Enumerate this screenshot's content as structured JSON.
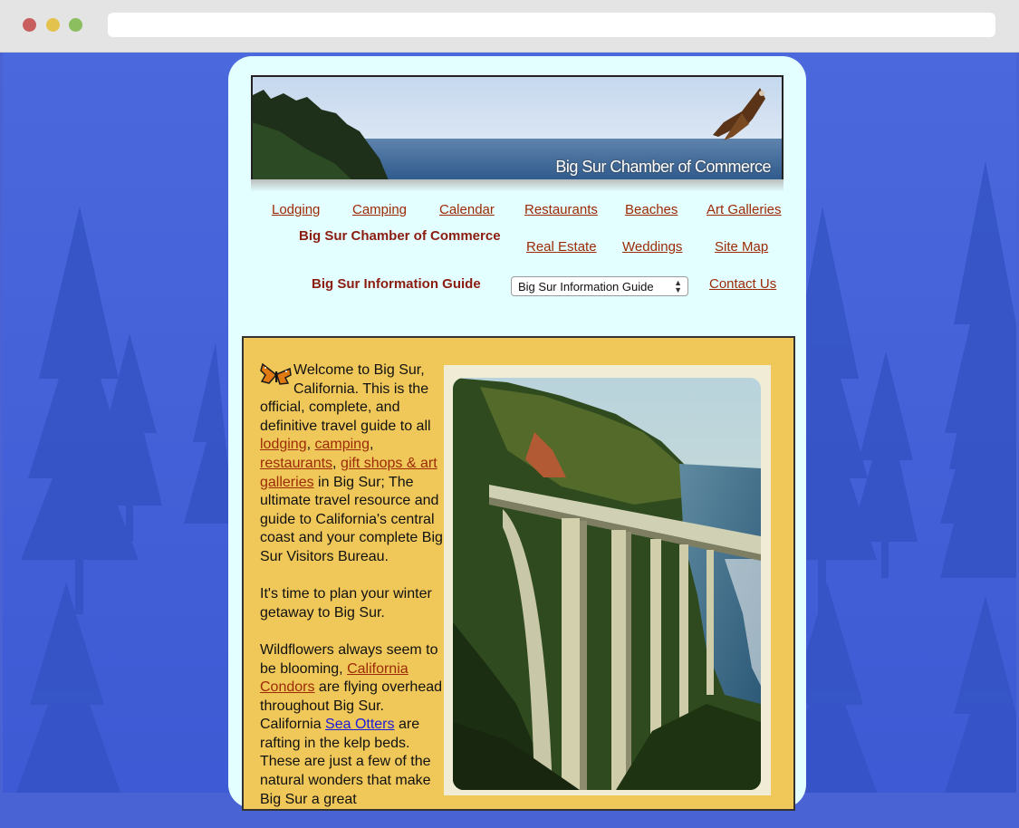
{
  "browser": {
    "url": ""
  },
  "banner": {
    "title": "Big Sur Chamber of Commerce"
  },
  "nav": {
    "lodging": "Lodging",
    "camping": "Camping",
    "calendar": "Calendar",
    "restaurants": "Restaurants",
    "beaches": "Beaches",
    "art_galleries": "Art Galleries",
    "real_estate": "Real Estate",
    "weddings": "Weddings",
    "site_map": "Site Map",
    "contact_us": "Contact Us",
    "chamber_label": "Big Sur Chamber of Commerce",
    "guide_label": "Big Sur Information Guide"
  },
  "guide_select": {
    "selected": "Big Sur Information Guide"
  },
  "content": {
    "p1_text_a": "Welcome to Big Sur, California. This is the official, complete, and definitive travel guide to all ",
    "link_lodging": "lodging",
    "sep1": ", ",
    "link_camping": "camping",
    "sep2": ", ",
    "link_restaurants": "restaurants",
    "sep3": ", ",
    "link_gifts": "gift shops & art galleries",
    "p1_text_b": " in Big Sur; The ultimate travel resource and guide to California's central coast and your complete Big Sur Visitors Bureau.",
    "p2": "It's time to plan your winter getaway to Big Sur.",
    "p3_a": "Wildflowers always seem to be blooming, ",
    "link_condors": "California Condors",
    "p3_b": " are flying overhead throughout Big Sur. California ",
    "link_otters": "Sea Otters",
    "p3_c": " are rafting in the kelp beds. These are just a few of the natural wonders that make Big Sur a great"
  },
  "colors": {
    "page_bg": "#4a63d4",
    "card_bg": "#e4ffff",
    "panel_bg": "#f0c85a",
    "link": "#9b2a05",
    "label": "#8a1c10"
  },
  "icons": {
    "banner_bird": "condor-icon",
    "butterfly": "monarch-butterfly-icon",
    "trees": "pine-tree-icon"
  }
}
